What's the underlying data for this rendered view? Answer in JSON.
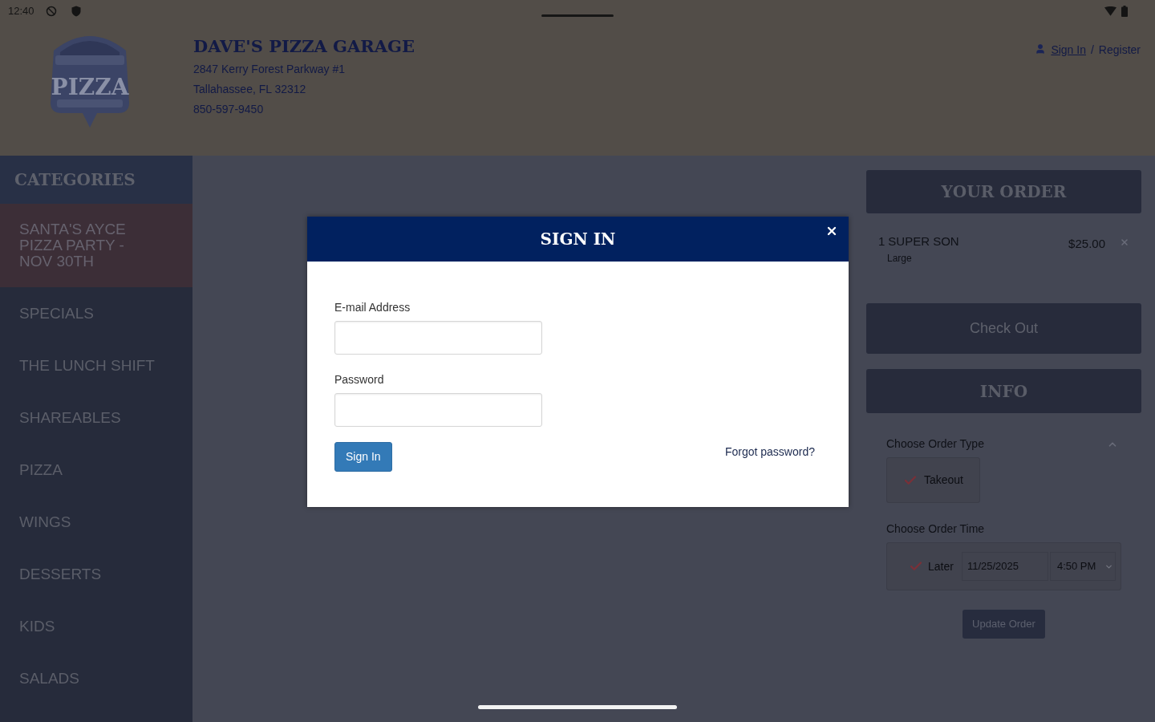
{
  "status_bar": {
    "time": "12:40"
  },
  "header": {
    "logo_text": "PIZZA",
    "name": "DAVE'S PIZZA GARAGE",
    "address_lines": [
      "2847 Kerry Forest Parkway #1",
      "Tallahassee, FL 32312",
      "850-597-9450"
    ],
    "account": {
      "sign_in": "Sign In",
      "separator": "/",
      "register": "Register"
    }
  },
  "sidebar": {
    "title": "CATEGORIES",
    "items": [
      {
        "label": "SANTA'S AYCE PIZZA PARTY - NOV 30TH",
        "selected": true
      },
      {
        "label": "SPECIALS",
        "selected": false
      },
      {
        "label": "THE LUNCH SHIFT",
        "selected": false
      },
      {
        "label": "SHAREABLES",
        "selected": false
      },
      {
        "label": "PIZZA",
        "selected": false
      },
      {
        "label": "WINGS",
        "selected": false
      },
      {
        "label": "DESSERTS",
        "selected": false
      },
      {
        "label": "KIDS",
        "selected": false
      },
      {
        "label": "SALADS",
        "selected": false
      }
    ]
  },
  "order": {
    "title": "YOUR ORDER",
    "items": [
      {
        "quantity": "1",
        "name": "SUPER SON",
        "option": "Large",
        "price": "$25.00"
      }
    ],
    "checkout_button": "Check Out"
  },
  "info": {
    "title": "INFO",
    "order_type": {
      "label": "Choose Order Type",
      "options": [
        {
          "label": "Takeout",
          "checked": true
        }
      ]
    },
    "order_time": {
      "label": "Choose Order Time",
      "option": {
        "label": "Later",
        "checked": true
      },
      "date": "11/25/2025",
      "time": "4:50 PM"
    },
    "update_button": "Update Order"
  },
  "modal": {
    "title": "SIGN IN",
    "fields": [
      {
        "label": "E-mail Address"
      },
      {
        "label": "Password"
      }
    ],
    "submit_button": "Sign In",
    "forgot_link": "Forgot password?"
  }
}
